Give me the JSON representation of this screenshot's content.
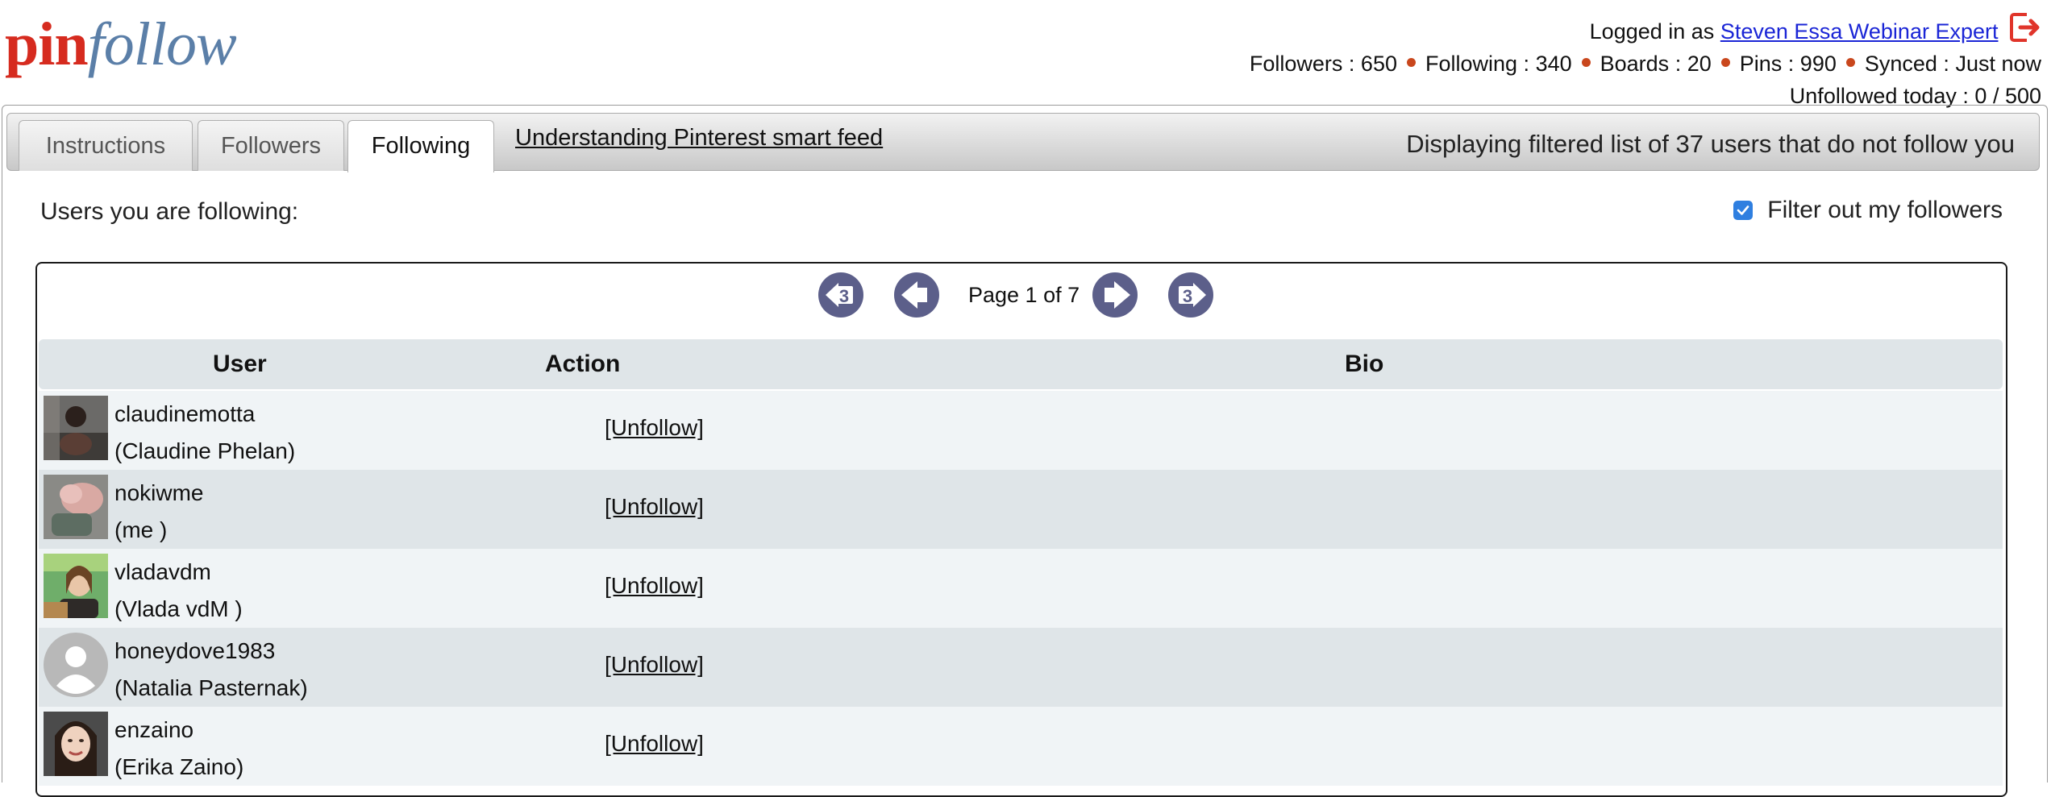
{
  "logo": {
    "part1": "pin",
    "part2": "follow"
  },
  "header": {
    "logged_in_prefix": "Logged in as",
    "user_link": "Steven Essa Webinar Expert",
    "stats": [
      {
        "label": "Followers",
        "value": "650"
      },
      {
        "label": "Following",
        "value": "340"
      },
      {
        "label": "Boards",
        "value": "20"
      },
      {
        "label": "Pins",
        "value": "990"
      },
      {
        "label": "Synced",
        "value": "Just now"
      }
    ],
    "unfollowed_label": "Unfollowed today : 0 / 500",
    "accent_color": "#d62b1f",
    "dot_color": "#c9471d"
  },
  "tabs": [
    {
      "label": "Instructions"
    },
    {
      "label": "Followers"
    },
    {
      "label": "Following",
      "active": true
    }
  ],
  "smart_feed_link": "Understanding Pinterest smart feed",
  "display_status": "Displaying filtered list of 37 users that do not follow you",
  "list_label": "Users you are following:",
  "filter": {
    "label": "Filter out my followers",
    "checked": true
  },
  "pager": {
    "text": "Page 1 of 7",
    "jump": "3"
  },
  "table": {
    "headers": [
      "User",
      "Action",
      "Bio"
    ],
    "rows": [
      {
        "username": "claudinemotta",
        "realname": "(Claudine Phelan)",
        "action": "[Unfollow]",
        "bio": ""
      },
      {
        "username": "nokiwme",
        "realname": "(me )",
        "action": "[Unfollow]",
        "bio": ""
      },
      {
        "username": "vladavdm",
        "realname": "(Vlada vdM )",
        "action": "[Unfollow]",
        "bio": ""
      },
      {
        "username": "honeydove1983",
        "realname": "(Natalia Pasternak)",
        "action": "[Unfollow]",
        "bio": ""
      },
      {
        "username": "enzaino",
        "realname": "(Erika Zaino)",
        "action": "[Unfollow]",
        "bio": ""
      }
    ]
  }
}
